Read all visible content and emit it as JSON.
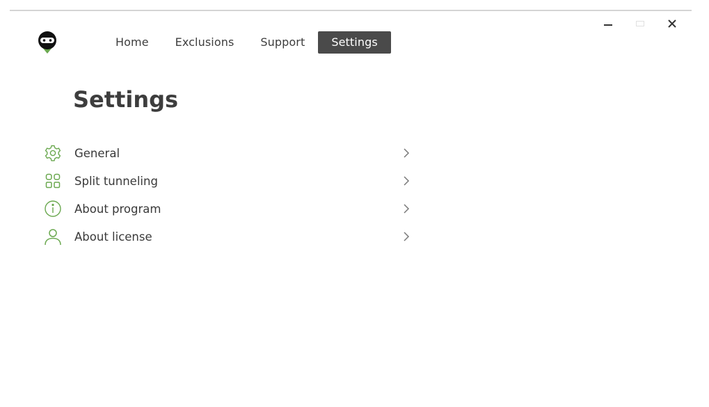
{
  "app": {
    "logo_icon": "ninja-mask-logo",
    "accent_color": "#6aa84f"
  },
  "nav": {
    "items": [
      {
        "label": "Home",
        "active": false
      },
      {
        "label": "Exclusions",
        "active": false
      },
      {
        "label": "Support",
        "active": false
      },
      {
        "label": "Settings",
        "active": true
      }
    ]
  },
  "window_controls": {
    "minimize": "minimize-icon",
    "maximize": "maximize-icon",
    "close": "close-icon"
  },
  "page": {
    "title": "Settings"
  },
  "settings_menu": {
    "items": [
      {
        "label": "General",
        "icon": "gear-icon"
      },
      {
        "label": "Split tunneling",
        "icon": "grid-icon"
      },
      {
        "label": "About program",
        "icon": "info-icon"
      },
      {
        "label": "About license",
        "icon": "user-icon"
      }
    ]
  }
}
